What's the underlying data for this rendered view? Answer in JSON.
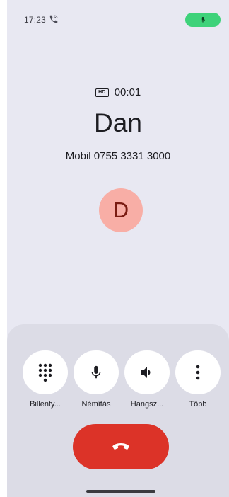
{
  "status_bar": {
    "time": "17:23",
    "call_icon": "phone-in-call-icon",
    "mic_indicator_icon": "mic-icon",
    "mic_indicator_color": "#3ed27a"
  },
  "call": {
    "hd_label": "HD",
    "timer": "00:01",
    "caller_name": "Dan",
    "caller_number": "Mobil 0755 3331 3000",
    "avatar_letter": "D",
    "avatar_color": "#f8aea6"
  },
  "controls": [
    {
      "label": "Billenty...",
      "icon": "dialpad-icon"
    },
    {
      "label": "Némítás",
      "icon": "mic-icon"
    },
    {
      "label": "Hangsz...",
      "icon": "speaker-icon"
    },
    {
      "label": "Több",
      "icon": "more-vert-icon"
    }
  ],
  "end_call": {
    "icon": "call-end-icon",
    "color": "#dc3328"
  }
}
